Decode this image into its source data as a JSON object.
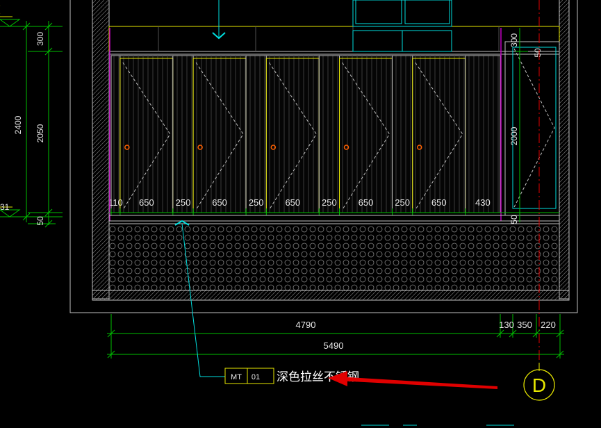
{
  "drawing": {
    "left_dims": {
      "total": "2400",
      "top": "300",
      "middle": "2050",
      "bottom": "50",
      "cut_off": "31"
    },
    "stall_dims": [
      "110",
      "650",
      "250",
      "650",
      "250",
      "650",
      "250",
      "650",
      "250",
      "650",
      "430"
    ],
    "right_dims": {
      "top": "300",
      "small": "50",
      "door_height": "2000",
      "bottom": "50"
    },
    "bottom_dims": {
      "row1": [
        "4790",
        "130",
        "350",
        "220"
      ],
      "row2": "5490"
    },
    "material_tag": {
      "code": "MT",
      "number": "01",
      "description": "深色拉丝不锈钢"
    },
    "grid_marker": "D"
  },
  "colors": {
    "background": "#000000",
    "green_dim": "#00c000",
    "yellow": "#e8e800",
    "cyan": "#00e0e0",
    "magenta": "#c000c0",
    "white": "#e8e8e8",
    "red": "#e00000",
    "gray": "#a0a0a0"
  }
}
